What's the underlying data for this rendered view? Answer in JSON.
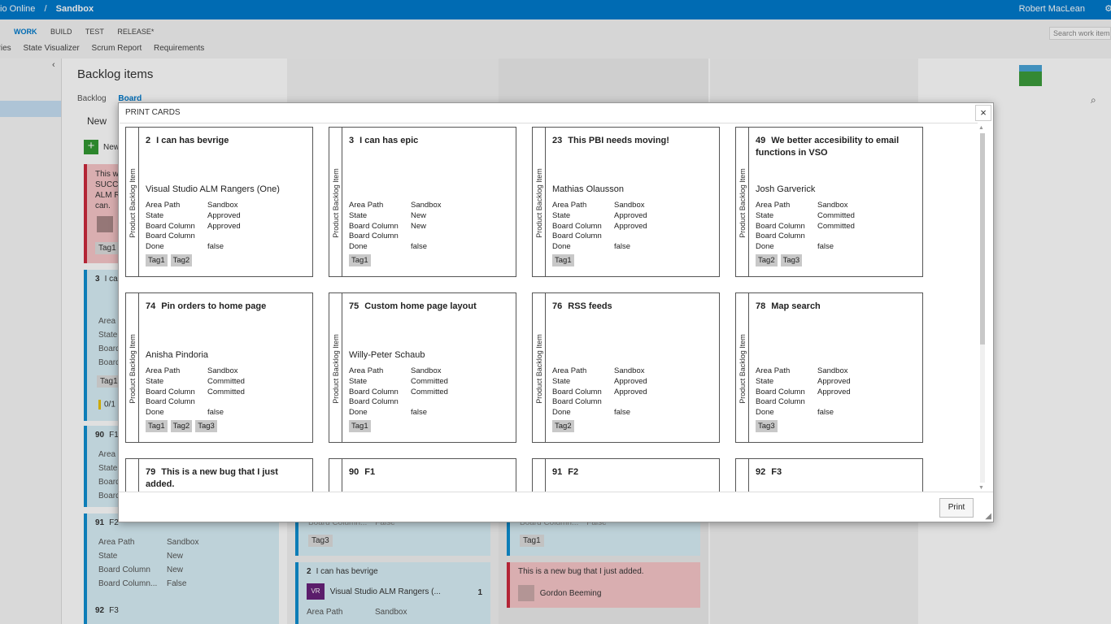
{
  "topbar": {
    "breadcrumb_service": "io Online",
    "breadcrumb_sep": "/",
    "project": "Sandbox",
    "user": "Robert MacLean",
    "settings_icon": "gear-icon"
  },
  "hubs": [
    "WORK",
    "BUILD",
    "TEST",
    "RELEASE*"
  ],
  "subhubs": [
    "eries",
    "State Visualizer",
    "Scrum Report",
    "Requirements"
  ],
  "search_placeholder": "Search work items",
  "page": {
    "title": "Backlog items",
    "views": [
      "Backlog",
      "Board"
    ],
    "column_new": "New",
    "new_item_label": "New"
  },
  "background_cards": {
    "red_top": {
      "text": "This wa\nSUCCE\nALM Ra\ncan.",
      "tag": "Tag1"
    },
    "blue_3": {
      "id": "3",
      "title": "I ca",
      "fields": [
        "Area Pa",
        "State",
        "Board",
        "Board"
      ],
      "tag": "Tag1",
      "count": "0/1"
    },
    "blue_90": {
      "id": "90",
      "title": "F1",
      "fields": [
        "Area Pa",
        "State",
        "Board",
        "Board"
      ]
    },
    "blue_91": {
      "id": "91",
      "title": "F2",
      "fields": [
        {
          "label": "Area Path",
          "value": "Sandbox"
        },
        {
          "label": "State",
          "value": "New"
        },
        {
          "label": "Board Column",
          "value": "New"
        },
        {
          "label": "Board Column...",
          "value": "False"
        }
      ]
    },
    "blue_92": {
      "id": "92",
      "title": "F3"
    },
    "mid_top": {
      "partial_field": "Board Column...",
      "partial_value": "False",
      "tag": "Tag3"
    },
    "mid_2": {
      "id": "2",
      "title": "I can has bevrige",
      "avatar_text": "VR",
      "owner": "Visual Studio ALM Rangers (...",
      "count": "1",
      "field_label": "Area Path",
      "field_value": "Sandbox"
    },
    "right_top": {
      "partial_field": "Board Column...",
      "partial_value": "False",
      "tag": "Tag1"
    },
    "right_bug": {
      "title": "This is a new bug that I just added.",
      "owner": "Gordon Beeming"
    }
  },
  "dialog": {
    "title": "PRINT CARDS",
    "close_label": "×",
    "print_label": "Print",
    "side_label": "Product Backlog Item",
    "cards": [
      {
        "id": "2",
        "title": "I can has bevrige",
        "owner": "Visual Studio ALM Rangers (One)",
        "fields": [
          [
            "Area Path",
            "Sandbox"
          ],
          [
            "State",
            "Approved"
          ],
          [
            "Board Column",
            "Approved"
          ],
          [
            "Board Column",
            ""
          ],
          [
            "Done",
            "false"
          ]
        ],
        "tags": [
          "Tag1",
          "Tag2"
        ]
      },
      {
        "id": "3",
        "title": "I can has epic",
        "owner": "",
        "fields": [
          [
            "Area Path",
            "Sandbox"
          ],
          [
            "State",
            "New"
          ],
          [
            "Board Column",
            "New"
          ],
          [
            "Board Column",
            ""
          ],
          [
            "Done",
            "false"
          ]
        ],
        "tags": [
          "Tag1"
        ]
      },
      {
        "id": "23",
        "title": "This PBI needs moving!",
        "owner": "Mathias Olausson",
        "fields": [
          [
            "Area Path",
            "Sandbox"
          ],
          [
            "State",
            "Approved"
          ],
          [
            "Board Column",
            "Approved"
          ],
          [
            "Board Column",
            ""
          ],
          [
            "Done",
            "false"
          ]
        ],
        "tags": [
          "Tag1"
        ]
      },
      {
        "id": "49",
        "title": "We better accesibility to email functions in VSO",
        "owner": "Josh Garverick",
        "fields": [
          [
            "Area Path",
            "Sandbox"
          ],
          [
            "State",
            "Committed"
          ],
          [
            "Board Column",
            "Committed"
          ],
          [
            "Board Column",
            ""
          ],
          [
            "Done",
            "false"
          ]
        ],
        "tags": [
          "Tag2",
          "Tag3"
        ]
      },
      {
        "id": "74",
        "title": "Pin orders to home page",
        "owner": "Anisha Pindoria",
        "fields": [
          [
            "Area Path",
            "Sandbox"
          ],
          [
            "State",
            "Committed"
          ],
          [
            "Board Column",
            "Committed"
          ],
          [
            "Board Column",
            ""
          ],
          [
            "Done",
            "false"
          ]
        ],
        "tags": [
          "Tag1",
          "Tag2",
          "Tag3"
        ]
      },
      {
        "id": "75",
        "title": "Custom home page layout",
        "owner": "Willy-Peter Schaub",
        "fields": [
          [
            "Area Path",
            "Sandbox"
          ],
          [
            "State",
            "Committed"
          ],
          [
            "Board Column",
            "Committed"
          ],
          [
            "Board Column",
            ""
          ],
          [
            "Done",
            "false"
          ]
        ],
        "tags": [
          "Tag1"
        ]
      },
      {
        "id": "76",
        "title": "RSS feeds",
        "owner": "",
        "fields": [
          [
            "Area Path",
            "Sandbox"
          ],
          [
            "State",
            "Approved"
          ],
          [
            "Board Column",
            "Approved"
          ],
          [
            "Board Column",
            ""
          ],
          [
            "Done",
            "false"
          ]
        ],
        "tags": [
          "Tag2"
        ]
      },
      {
        "id": "78",
        "title": "Map search",
        "owner": "",
        "fields": [
          [
            "Area Path",
            "Sandbox"
          ],
          [
            "State",
            "Approved"
          ],
          [
            "Board Column",
            "Approved"
          ],
          [
            "Board Column",
            ""
          ],
          [
            "Done",
            "false"
          ]
        ],
        "tags": [
          "Tag3"
        ]
      },
      {
        "id": "79",
        "title": "This is a new bug that I just added.",
        "owner": "",
        "fields": [],
        "tags": []
      },
      {
        "id": "90",
        "title": "F1",
        "owner": "",
        "fields": [],
        "tags": []
      },
      {
        "id": "91",
        "title": "F2",
        "owner": "",
        "fields": [],
        "tags": []
      },
      {
        "id": "92",
        "title": "F3",
        "owner": "",
        "fields": [],
        "tags": []
      }
    ]
  },
  "colors": {
    "topbar": "#007acc",
    "card_blue": "#d9f0f7",
    "card_red": "#f7c6c9",
    "tag_gray": "#c8c8c8"
  }
}
